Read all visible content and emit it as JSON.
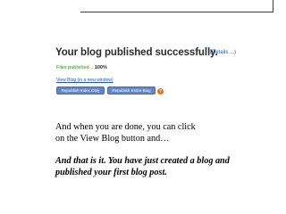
{
  "screenshot": {
    "title": "Your blog published successfully.",
    "details_label": "(Details",
    "details_dots": "...",
    "details_close": ")",
    "progress_label": "Files published...",
    "progress_value": "100%",
    "view_blog_link": "View Blog (in a new window)",
    "buttons": {
      "view_label": "Republish Index Only",
      "republish_label": "Republish Entire Blog"
    },
    "help_icon": "help-icon",
    "help_glyph": "?"
  },
  "slide": {
    "line1": "And when you are done, you can click",
    "line2": "on the View Blog button and…",
    "closing_line1": "And that is it.  You have just created a blog and",
    "closing_line2": "published your first blog post."
  },
  "colors": {
    "title_text": "#2b2b2b",
    "link_blue": "#1a57c2",
    "success_green": "#2c8a1f",
    "button_blue": "#5f86c9",
    "help_orange": "#e46b1c",
    "rule_navy": "#1f3f6f"
  }
}
